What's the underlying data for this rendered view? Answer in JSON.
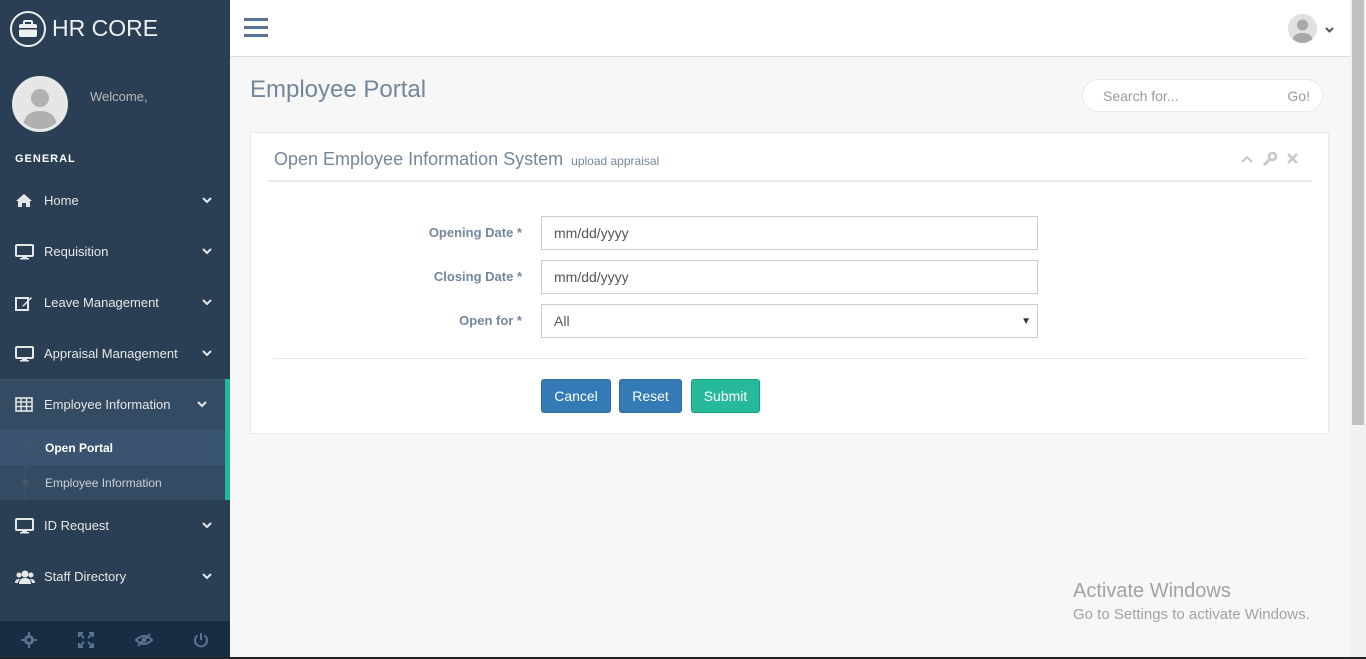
{
  "brand": {
    "title": "HR CORE",
    "icon": "briefcase-icon"
  },
  "profile": {
    "welcome": "Welcome,"
  },
  "sidebar": {
    "section": "GENERAL",
    "items": [
      {
        "label": "Home",
        "icon": "home-icon"
      },
      {
        "label": "Requisition",
        "icon": "desktop-icon"
      },
      {
        "label": "Leave Management",
        "icon": "edit-icon"
      },
      {
        "label": "Appraisal Management",
        "icon": "desktop-icon"
      },
      {
        "label": "Employee Information",
        "icon": "table-icon"
      },
      {
        "label": "ID Request",
        "icon": "desktop-icon"
      },
      {
        "label": "Staff Directory",
        "icon": "users-icon"
      }
    ],
    "submenu": [
      {
        "label": "Open Portal"
      },
      {
        "label": "Employee Information"
      }
    ],
    "footer": [
      "settings-icon",
      "fullscreen-icon",
      "eye-slash-icon",
      "power-icon"
    ]
  },
  "main": {
    "title": "Employee Portal",
    "search": {
      "placeholder": "Search for...",
      "button": "Go!"
    }
  },
  "panel": {
    "title": "Open Employee Information System",
    "subtitle": "upload appraisal",
    "fields": {
      "opening": {
        "label": "Opening Date *",
        "value": "mm/dd/yyyy"
      },
      "closing": {
        "label": "Closing Date *",
        "value": "mm/dd/yyyy"
      },
      "open_for": {
        "label": "Open for *",
        "value": "All"
      }
    },
    "buttons": {
      "cancel": "Cancel",
      "reset": "Reset",
      "submit": "Submit"
    }
  },
  "watermark": {
    "title": "Activate Windows",
    "subtitle": "Go to Settings to activate Windows."
  },
  "colors": {
    "sidebar": "#2A3F54",
    "accent": "#1ABB9C",
    "primary": "#337AB7",
    "success": "#26B99A"
  }
}
